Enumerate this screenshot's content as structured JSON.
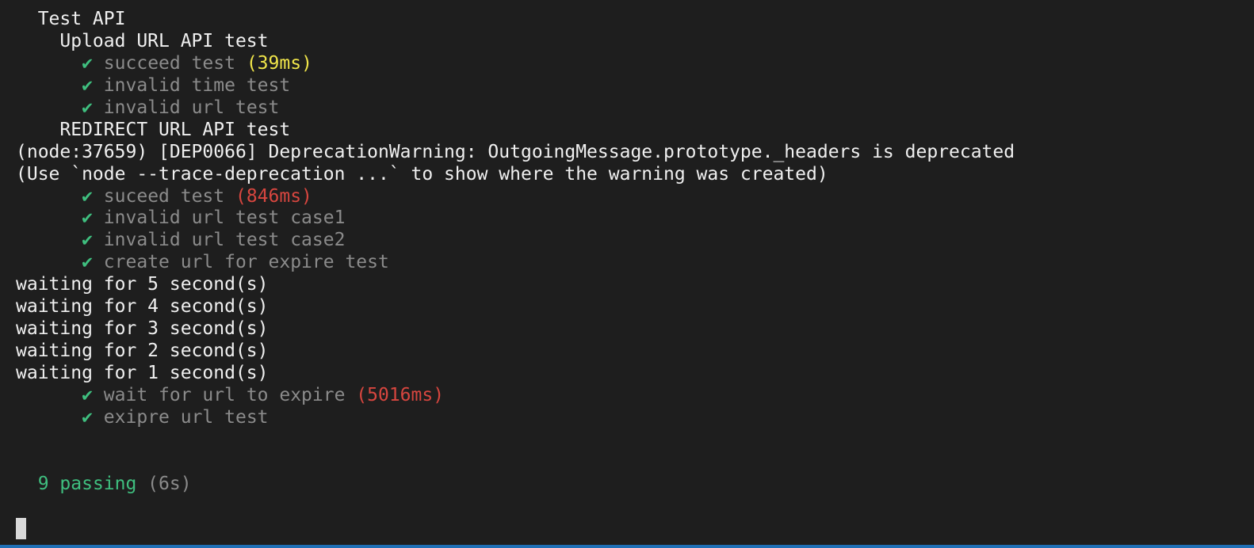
{
  "terminal": {
    "colors": {
      "background": "#1e1e1e",
      "text": "#f0f0f0",
      "dim": "#8b8b8b",
      "pass": "#3fbf7f",
      "medium_duration": "#f0e54a",
      "slow_duration": "#d7463f",
      "status_bar": "#1f6fb5"
    },
    "lines": [
      {
        "suite": "  Test API"
      },
      {
        "suite": "    Upload URL API test"
      },
      {
        "indent": "      ",
        "check": "✔",
        "text": " succeed test ",
        "duration": "(39ms)",
        "duration_level": "medium"
      },
      {
        "indent": "      ",
        "check": "✔",
        "text": " invalid time test"
      },
      {
        "indent": "      ",
        "check": "✔",
        "text": " invalid url test"
      },
      {
        "suite": "    REDIRECT URL API test"
      },
      {
        "log": "(node:37659) [DEP0066] DeprecationWarning: OutgoingMessage.prototype._headers is deprecated"
      },
      {
        "log": "(Use `node --trace-deprecation ...` to show where the warning was created)"
      },
      {
        "indent": "      ",
        "check": "✔",
        "text": " suceed test ",
        "duration": "(846ms)",
        "duration_level": "slow"
      },
      {
        "indent": "      ",
        "check": "✔",
        "text": " invalid url test case1"
      },
      {
        "indent": "      ",
        "check": "✔",
        "text": " invalid url test case2"
      },
      {
        "indent": "      ",
        "check": "✔",
        "text": " create url for expire test"
      },
      {
        "log": "waiting for 5 second(s)"
      },
      {
        "log": "waiting for 4 second(s)"
      },
      {
        "log": "waiting for 3 second(s)"
      },
      {
        "log": "waiting for 2 second(s)"
      },
      {
        "log": "waiting for 1 second(s)"
      },
      {
        "indent": "      ",
        "check": "✔",
        "text": " wait for url to expire ",
        "duration": "(5016ms)",
        "duration_level": "slow"
      },
      {
        "indent": "      ",
        "check": "✔",
        "text": " exipre url test"
      }
    ],
    "summary": {
      "indent": "  ",
      "passing": "9 passing",
      "time": " (6s)"
    }
  }
}
